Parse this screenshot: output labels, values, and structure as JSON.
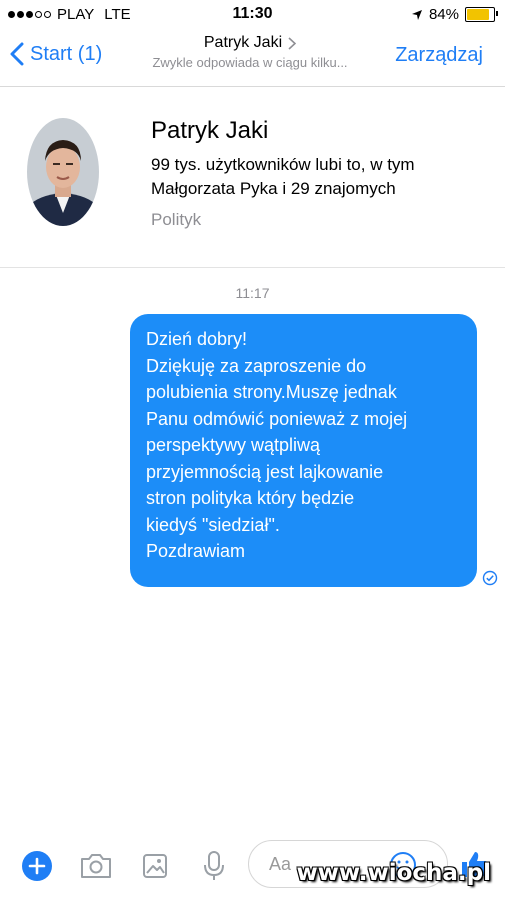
{
  "status_bar": {
    "carrier": "PLAY",
    "network": "LTE",
    "time": "11:30",
    "battery": "84%",
    "battery_level": 0.84,
    "signal_dots_filled": 3,
    "signal_dots_total": 5
  },
  "nav": {
    "back_label": "Start (1)",
    "title": "Patryk Jaki",
    "subtitle": "Zwykle odpowiada w ciągu kilku...",
    "manage_label": "Zarządzaj"
  },
  "profile": {
    "name": "Patryk Jaki",
    "likes_line1": "99 tys. użytkowników lubi to, w tym",
    "likes_line2": "Małgorzata Pyka i 29 znajomych",
    "category": "Polityk"
  },
  "conversation": {
    "timestamp": "11:17",
    "message_lines": [
      "Dzień dobry!",
      "Dziękuję za zaproszenie do",
      "polubienia strony.Muszę jednak",
      "Panu odmówić ponieważ z mojej",
      "perspektywy wątpliwą",
      "przyjemnością jest lajkowanie",
      "stron polityka który będzie",
      "kiedyś \"siedział\".",
      "Pozdrawiam"
    ]
  },
  "composer": {
    "placeholder": "Aa"
  },
  "watermark": "www.wiocha.pl",
  "colors": {
    "accent": "#1f7ef5",
    "bubble": "#1c8df8"
  },
  "icons": [
    "plus-icon",
    "camera-icon",
    "image-icon",
    "microphone-icon",
    "emoji-icon",
    "thumbs-up-icon",
    "location-arrow-icon",
    "chevron-left-icon",
    "chevron-right-icon",
    "seen-check-icon"
  ]
}
